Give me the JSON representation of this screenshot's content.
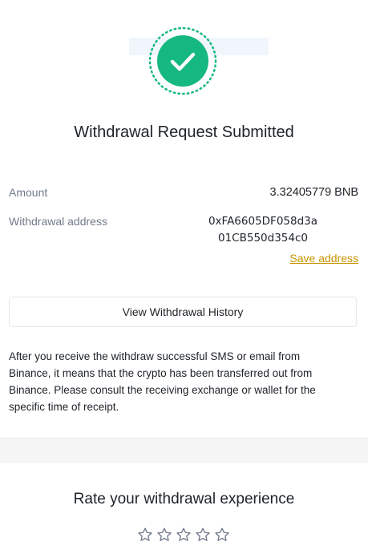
{
  "status": {
    "title": "Withdrawal Request Submitted",
    "icon": "success-check-icon",
    "accent_color": "#16b882"
  },
  "details": {
    "amount_label": "Amount",
    "amount_value": "3.32405779 BNB",
    "address_label": "Withdrawal address",
    "address_line1": "0xFA6605DF058d3a",
    "address_line2": "01CB550d354c0",
    "save_address_label": "Save address",
    "link_color": "#c99400"
  },
  "actions": {
    "history_button_label": "View Withdrawal History"
  },
  "notice": {
    "text": "After you receive the withdraw successful SMS or email from Binance, it means that the crypto has been transferred out from Binance. Please consult the receiving exchange or wallet for the specific time of receipt."
  },
  "rating": {
    "title": "Rate your withdrawal experience",
    "star_icon": "star-outline-icon",
    "stars_total": 5,
    "stars_selected": 0
  }
}
